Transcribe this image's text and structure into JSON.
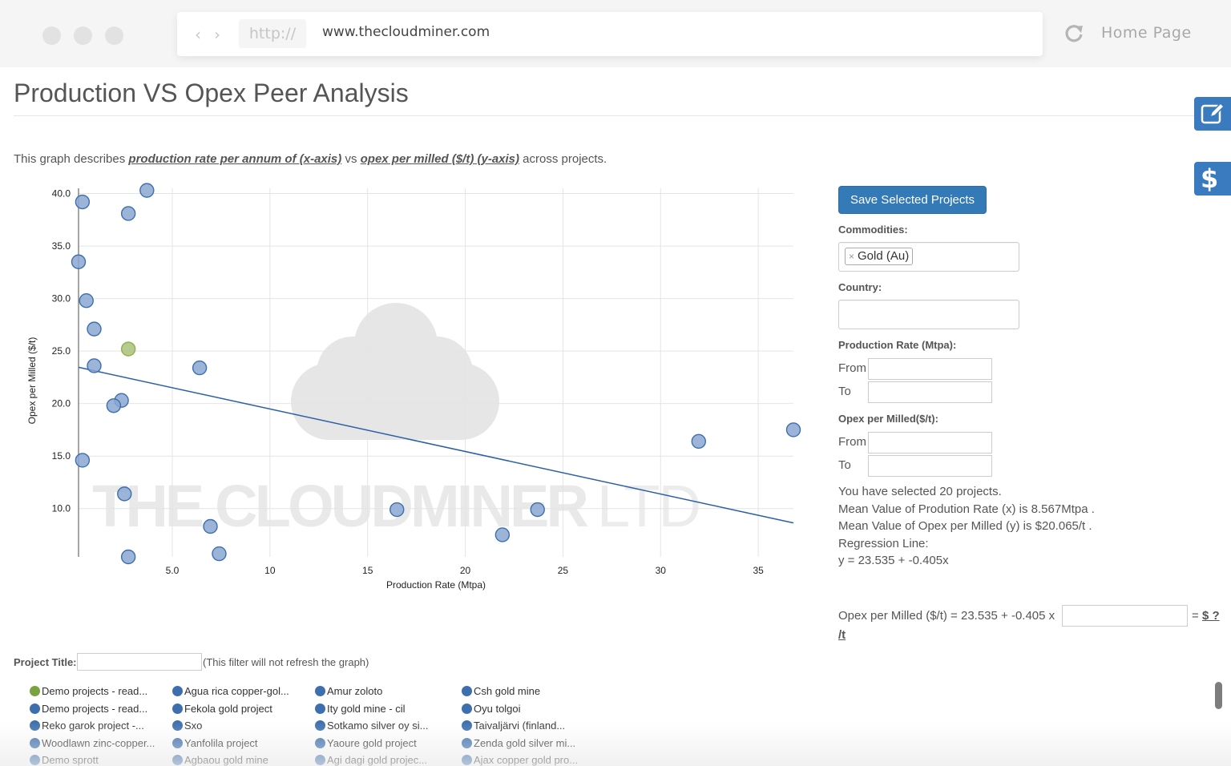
{
  "browser": {
    "protocol": "http://",
    "url": "www.thecloudminer.com",
    "home_label": "Home Page",
    "back_icon": "‹",
    "forward_icon": "›"
  },
  "page": {
    "title": "Production VS Opex Peer Analysis",
    "description": {
      "prefix": "This graph describes ",
      "x_desc": "production rate per annum of (x-axis)",
      "middle": " vs ",
      "y_desc": "opex per milled ($/t) (y-axis)",
      "suffix": " across projects."
    },
    "side_buttons": [
      {
        "icon": "edit-icon"
      },
      {
        "icon": "dollar-icon",
        "glyph": "$"
      }
    ]
  },
  "filters": {
    "save_label": "Save Selected Projects",
    "commodities_label": "Commodities:",
    "commodity_tags": [
      {
        "label": "Gold (Au)",
        "remove": "×"
      }
    ],
    "country_label": "Country:",
    "country_value": "",
    "production_label": "Production Rate (Mtpa):",
    "opex_label": "Opex per Milled($/t):",
    "from_label": "From",
    "to_label": "To",
    "production_from": "",
    "production_to": "",
    "opex_from": "",
    "opex_to": ""
  },
  "stats": {
    "selected": "You have selected 20 projects.",
    "mean_x": "Mean Value of Prodution Rate (x) is 8.567Mtpa .",
    "mean_y": "Mean Value of Opex per Milled (y) is $20.065/t .",
    "regression_label": "Regression Line:",
    "regression_eq": "y = 23.535 + -0.405x"
  },
  "calculator": {
    "formula": "Opex per Milled ($/t) = 23.535 + -0.405 x",
    "input_value": "",
    "equals": "= ",
    "result": "$ ?",
    "unit": "/t"
  },
  "project_filter": {
    "label": "Project Title:",
    "value": "",
    "note": "(This filter will not refresh the graph)"
  },
  "legend": {
    "columns": [
      [
        {
          "label": "Demo projects - read...",
          "color": "#7aa23f"
        },
        {
          "label": "Demo projects - read...",
          "color": "#3d6fae"
        },
        {
          "label": "Reko garok project -...",
          "color": "#3d6fae"
        },
        {
          "label": "Woodlawn zinc-copper...",
          "color": "#3d6fae"
        },
        {
          "label": "Demo sprott",
          "color": "#3d6fae"
        }
      ],
      [
        {
          "label": "Agua rica copper-gol...",
          "color": "#3d6fae"
        },
        {
          "label": "Fekola gold project",
          "color": "#3d6fae"
        },
        {
          "label": "Sxo",
          "color": "#3d6fae"
        },
        {
          "label": "Yanfolila project",
          "color": "#3d6fae"
        },
        {
          "label": "Agbaou gold mine",
          "color": "#3d6fae"
        }
      ],
      [
        {
          "label": "Amur zoloto",
          "color": "#3d6fae"
        },
        {
          "label": "Ity gold mine - cil",
          "color": "#3d6fae"
        },
        {
          "label": "Sotkamo silver oy si...",
          "color": "#3d6fae"
        },
        {
          "label": "Yaoure gold project",
          "color": "#3d6fae"
        },
        {
          "label": "Agi dagi gold projec...",
          "color": "#3d6fae"
        }
      ],
      [
        {
          "label": "Csh gold mine",
          "color": "#3d6fae"
        },
        {
          "label": "Oyu tolgoi",
          "color": "#3d6fae"
        },
        {
          "label": "Taivaljärvi (finland...",
          "color": "#3d6fae"
        },
        {
          "label": "Zenda gold silver mi...",
          "color": "#3d6fae"
        },
        {
          "label": "Ajax copper gold pro...",
          "color": "#3d6fae"
        }
      ]
    ]
  },
  "chart_data": {
    "type": "scatter",
    "title": "",
    "xlabel": "Production Rate (Mtpa)",
    "ylabel": "Opex per Milled ($/t)",
    "xlim": [
      0.2,
      36.8
    ],
    "ylim": [
      5.4,
      40.5
    ],
    "xticks": [
      5,
      10,
      15,
      20,
      25,
      30,
      35
    ],
    "xtick_labels": [
      "5.0",
      "10",
      "15",
      "20",
      "25",
      "30",
      "35"
    ],
    "yticks": [
      10,
      15,
      20,
      25,
      30,
      35,
      40
    ],
    "ytick_labels": [
      "10.0",
      "15.0",
      "20.0",
      "25.0",
      "30.0",
      "35.0",
      "40.0"
    ],
    "grid": true,
    "watermark": "THE CLOUDMINER LTD",
    "colors": {
      "point": "#3d6fae",
      "highlight": "#8fae4f",
      "line": "#2a5fa5"
    },
    "points": [
      {
        "x": 0.4,
        "y": 39.2
      },
      {
        "x": 3.7,
        "y": 40.3
      },
      {
        "x": 2.75,
        "y": 38.1
      },
      {
        "x": 0.2,
        "y": 33.5
      },
      {
        "x": 0.6,
        "y": 29.8
      },
      {
        "x": 1.0,
        "y": 27.1
      },
      {
        "x": 2.75,
        "y": 25.2,
        "highlight": true
      },
      {
        "x": 1.0,
        "y": 23.6
      },
      {
        "x": 6.4,
        "y": 23.4
      },
      {
        "x": 2.4,
        "y": 20.3
      },
      {
        "x": 2.0,
        "y": 19.8
      },
      {
        "x": 0.4,
        "y": 14.6
      },
      {
        "x": 2.55,
        "y": 11.4
      },
      {
        "x": 6.95,
        "y": 8.3
      },
      {
        "x": 2.75,
        "y": 5.4
      },
      {
        "x": 7.4,
        "y": 5.7
      },
      {
        "x": 16.5,
        "y": 9.9
      },
      {
        "x": 21.9,
        "y": 7.5
      },
      {
        "x": 23.7,
        "y": 9.9
      },
      {
        "x": 31.95,
        "y": 16.4
      },
      {
        "x": 36.8,
        "y": 17.5
      }
    ],
    "regression": {
      "intercept": 23.535,
      "slope": -0.405
    }
  }
}
